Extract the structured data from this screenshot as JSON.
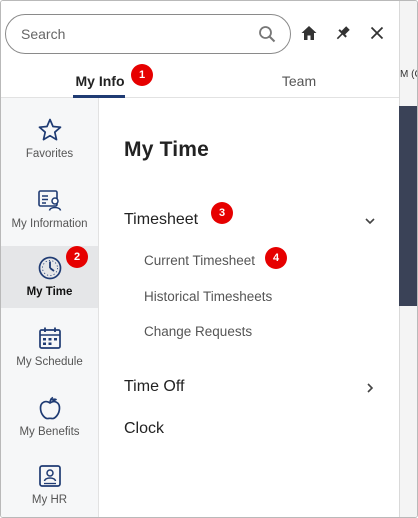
{
  "search": {
    "placeholder": "Search"
  },
  "backdrop": {
    "text": "M (C"
  },
  "tabs": [
    {
      "label": "My Info",
      "active": true
    },
    {
      "label": "Team",
      "active": false
    }
  ],
  "badges": {
    "b1": "1",
    "b2": "2",
    "b3": "3",
    "b4": "4"
  },
  "sidebar": {
    "items": [
      {
        "label": "Favorites",
        "icon": "star-icon",
        "active": false
      },
      {
        "label": "My Information",
        "icon": "id-card-icon",
        "active": false
      },
      {
        "label": "My Time",
        "icon": "clock-icon",
        "active": true
      },
      {
        "label": "My Schedule",
        "icon": "calendar-icon",
        "active": false
      },
      {
        "label": "My Benefits",
        "icon": "apple-icon",
        "active": false
      },
      {
        "label": "My HR",
        "icon": "badge-icon",
        "active": false
      }
    ]
  },
  "content": {
    "title": "My Time",
    "timesheet": {
      "label": "Timesheet",
      "expanded": true,
      "items": [
        "Current Timesheet",
        "Historical Timesheets",
        "Change Requests"
      ]
    },
    "time_off": {
      "label": "Time Off"
    },
    "clock": {
      "label": "Clock"
    }
  },
  "colors": {
    "accent": "#1f3b73",
    "badge": "#e60000",
    "sidebar_active_bg": "#e5e6e8"
  }
}
